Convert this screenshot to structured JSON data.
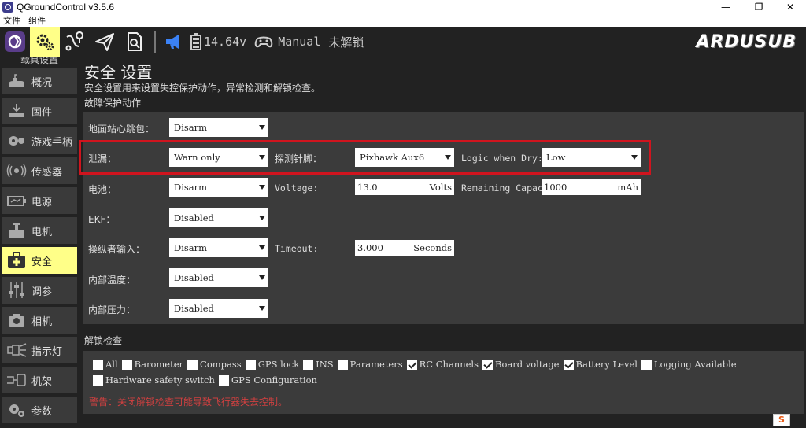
{
  "window": {
    "title": "QGroundControl v3.5.6",
    "minimize": "—",
    "maximize": "❐",
    "close": "✕"
  },
  "menubar": {
    "items": [
      "文件",
      "组件"
    ]
  },
  "toolbar": {
    "battery_voltage": "14.64v",
    "flight_mode": "Manual",
    "arm_status": "未解锁",
    "logo": "ARDUSUB"
  },
  "sidebar": {
    "clipped_label": "载具设置",
    "items": [
      {
        "label": "概况",
        "icon": "submarine-icon"
      },
      {
        "label": "固件",
        "icon": "download-icon"
      },
      {
        "label": "游戏手柄",
        "icon": "gamepad-icon"
      },
      {
        "label": "传感器",
        "icon": "sensor-icon"
      },
      {
        "label": "电源",
        "icon": "battery-icon"
      },
      {
        "label": "电机",
        "icon": "motor-icon"
      },
      {
        "label": "安全",
        "icon": "safety-icon"
      },
      {
        "label": "调参",
        "icon": "sliders-icon"
      },
      {
        "label": "相机",
        "icon": "camera-icon"
      },
      {
        "label": "指示灯",
        "icon": "lights-icon"
      },
      {
        "label": "机架",
        "icon": "frame-icon"
      },
      {
        "label": "参数",
        "icon": "gears-icon"
      }
    ]
  },
  "page": {
    "title": "安全 设置",
    "description": "安全设置用来设置失控保护动作，异常检测和解锁检查。",
    "failsafe_section": "故障保护动作",
    "arming_section": "解锁检查",
    "warning": "警告：关闭解锁检查可能导致飞行器失去控制。"
  },
  "failsafe": {
    "gcs_heartbeat": {
      "label": "地面站心跳包：",
      "value": "Disarm"
    },
    "leak": {
      "label": "泄漏：",
      "value": "Warn only"
    },
    "leak_pin": {
      "label": "探测针脚：",
      "value": "Pixhawk Aux6"
    },
    "leak_logic": {
      "label": "Logic when Dry:",
      "value": "Low"
    },
    "battery": {
      "label": "电池：",
      "value": "Disarm"
    },
    "voltage": {
      "label": "Voltage:",
      "value": "13.0",
      "unit": "Volts"
    },
    "remaining_capacity": {
      "label": "Remaining Capaci",
      "value": "1000",
      "unit": "mAh"
    },
    "ekf": {
      "label": "EKF：",
      "value": "Disabled"
    },
    "pilot_input": {
      "label": "操纵者输入：",
      "value": "Disarm"
    },
    "timeout": {
      "label": "Timeout:",
      "value": "3.000",
      "unit": "Seconds"
    },
    "internal_temp": {
      "label": "内部温度：",
      "value": "Disabled"
    },
    "internal_pressure": {
      "label": "内部压力：",
      "value": "Disabled"
    }
  },
  "arming_checks": [
    {
      "label": "All",
      "checked": false
    },
    {
      "label": "Barometer",
      "checked": false
    },
    {
      "label": "Compass",
      "checked": false
    },
    {
      "label": "GPS lock",
      "checked": false
    },
    {
      "label": "INS",
      "checked": false
    },
    {
      "label": "Parameters",
      "checked": false
    },
    {
      "label": "RC Channels",
      "checked": true
    },
    {
      "label": "Board voltage",
      "checked": true
    },
    {
      "label": "Battery Level",
      "checked": true
    },
    {
      "label": "Logging Available",
      "checked": false
    },
    {
      "label": "Hardware safety switch",
      "checked": false
    },
    {
      "label": "GPS Configuration",
      "checked": false
    }
  ],
  "tray": {
    "label": "S"
  },
  "colors": {
    "active": "#ffff88",
    "panel": "#3b3b3b",
    "highlight": "#d0141e",
    "warning": "#d04040",
    "accent_blue": "#3b82f6"
  }
}
